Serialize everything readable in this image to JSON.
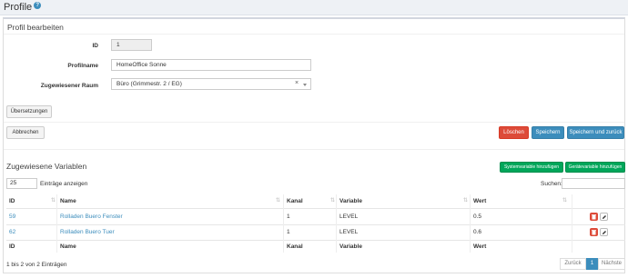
{
  "page": {
    "title": "Profile",
    "help_icon": "question-circle-icon"
  },
  "edit_section": {
    "title": "Profil bearbeiten",
    "id_label": "ID",
    "id_value": "1",
    "name_label": "Profilname",
    "name_value": "HomeOffice Sonne",
    "room_label": "Zugewiesener Raum",
    "room_value": "Büro (Grimmestr. 2 / EG)",
    "room_clear": "×"
  },
  "buttons": {
    "translations": "Übersetzungen",
    "cancel": "Abbrechen",
    "delete": "Löschen",
    "save": "Speichern",
    "save_back": "Speichern und zurück",
    "add_system_var": "Systemvariable hinzufügen",
    "add_device_var": "Gerätevariable hinzufügen"
  },
  "colors": {
    "primary": "#3c8dbc",
    "danger": "#dd4b39",
    "success": "#00a65a"
  },
  "variables": {
    "title": "Zugewiesene Variablen",
    "page_size": "25",
    "entries_label": "Einträge anzeigen",
    "search_label": "Suchen:",
    "search_value": "",
    "columns": [
      "ID",
      "Name",
      "Kanal",
      "Variable",
      "Wert"
    ],
    "rows": [
      {
        "id": "59",
        "name": "Rolladen Buero Fenster",
        "kanal": "1",
        "variable": "LEVEL",
        "wert": "0.5"
      },
      {
        "id": "62",
        "name": "Rolladen Buero Tuer",
        "kanal": "1",
        "variable": "LEVEL",
        "wert": "0.6"
      }
    ],
    "info": "1 bis 2 von 2 Einträgen",
    "pager": {
      "prev": "Zurück",
      "current": "1",
      "next": "Nächste"
    }
  }
}
